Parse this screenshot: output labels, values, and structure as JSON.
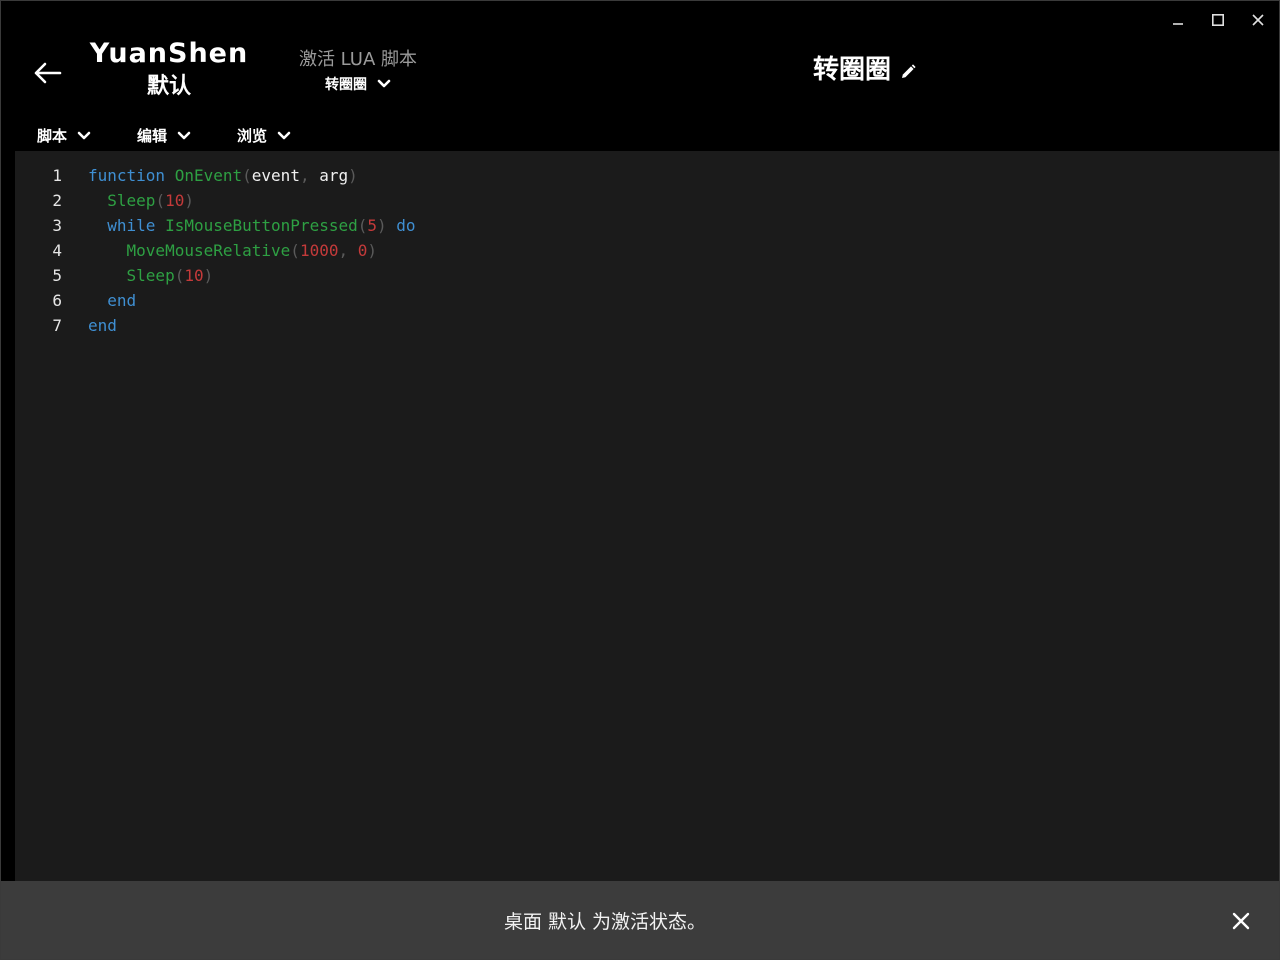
{
  "window_controls": {
    "minimize": "minimize-icon",
    "maximize": "maximize-icon",
    "close": "close-icon"
  },
  "header": {
    "back_icon": "arrow-left-icon",
    "profile_name": "YuanShen",
    "profile_mode": "默认",
    "activate_label": "激活 LUA 脚本",
    "activate_selected": "转圈圈",
    "script_title": "转圈圈",
    "edit_icon": "pencil-icon"
  },
  "menubar": {
    "items": [
      {
        "label": "脚本"
      },
      {
        "label": "编辑"
      },
      {
        "label": "浏览"
      }
    ]
  },
  "editor": {
    "lines": [
      {
        "num": "1"
      },
      {
        "num": "2"
      },
      {
        "num": "3"
      },
      {
        "num": "4"
      },
      {
        "num": "5"
      },
      {
        "num": "6"
      },
      {
        "num": "7"
      }
    ],
    "tokens": {
      "l1": [
        "function",
        "OnEvent",
        "(",
        "event",
        ",",
        "arg",
        ")"
      ],
      "l2": [
        "Sleep",
        "(",
        "10",
        ")"
      ],
      "l3": [
        "while",
        "IsMouseButtonPressed",
        "(",
        "5",
        ")",
        "do"
      ],
      "l4": [
        "MoveMouseRelative",
        "(",
        "1000",
        ",",
        "0",
        ")"
      ],
      "l5": [
        "Sleep",
        "(",
        "10",
        ")"
      ],
      "l6": [
        "end"
      ],
      "l7": [
        "end"
      ]
    }
  },
  "notification": {
    "text": "桌面 默认 为激活状态。",
    "close_icon": "close-icon"
  },
  "colors": {
    "keyword": "#3f8fd2",
    "function": "#2ea043",
    "number": "#c43a3a",
    "editor_bg": "#1b1b1b",
    "notice_bg": "#3c3c3c"
  }
}
